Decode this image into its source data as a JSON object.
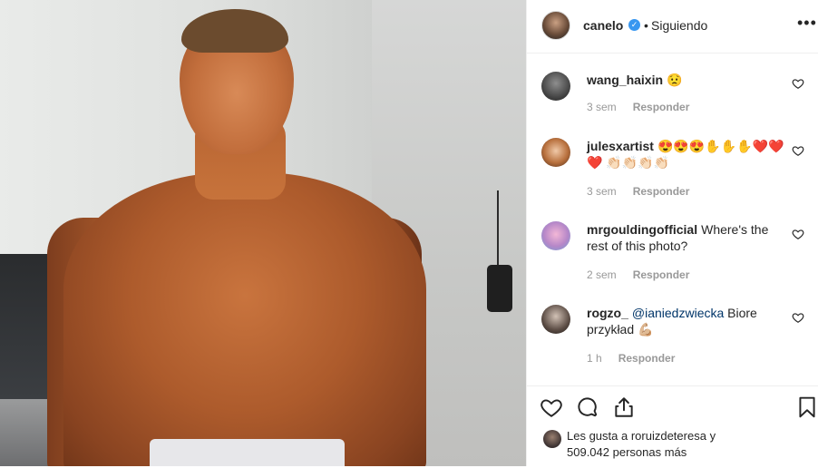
{
  "post": {
    "username": "canelo",
    "separator": "•",
    "follow_status": "Siguiendo",
    "more_label": "•••"
  },
  "comments": [
    {
      "user": "wang_haixin",
      "text": "😟",
      "mention": "",
      "time": "3 sem",
      "reply": "Responder"
    },
    {
      "user": "julesxartist",
      "text": "😍😍😍✋✋✋❤️❤️❤️ 👏🏻👏🏻👏🏻👏🏻",
      "mention": "",
      "time": "3 sem",
      "reply": "Responder"
    },
    {
      "user": "mrgouldingofficial",
      "text": "Where's the rest of this photo?",
      "mention": "",
      "time": "2 sem",
      "reply": "Responder"
    },
    {
      "user": "rogzo_",
      "text": " Biore przykład 💪🏼",
      "mention": "@ianiedzwiecka",
      "time": "1 h",
      "reply": "Responder"
    }
  ],
  "likes": {
    "prefix": "Les gusta a",
    "user": "roruizdeteresa",
    "middle": "y",
    "count": "509.042",
    "suffix": "personas más"
  },
  "icons": {
    "verified": "verified-badge-icon",
    "like": "heart-outline-icon",
    "comment": "comment-bubble-icon",
    "share": "share-icon",
    "save": "bookmark-icon"
  },
  "colors": {
    "verified_blue": "#3897f0",
    "mention": "#003569",
    "meta_gray": "#999999",
    "text": "#262626"
  }
}
